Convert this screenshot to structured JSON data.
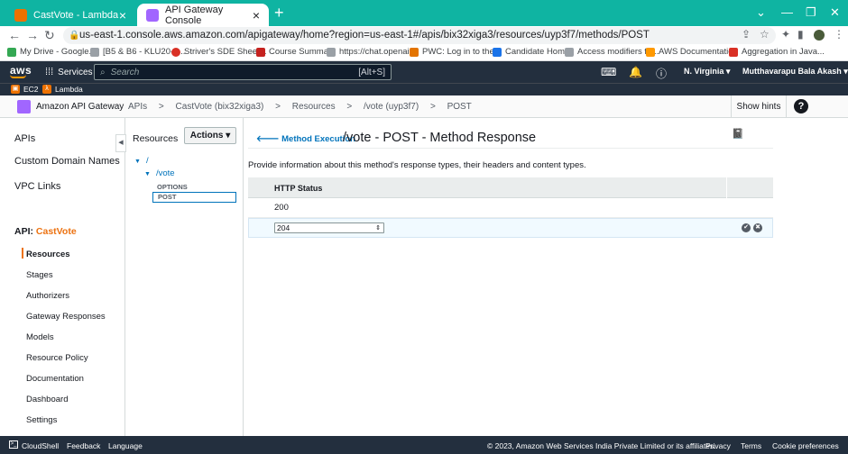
{
  "browser": {
    "tabs": [
      {
        "title": "CastVote - Lambda",
        "active": false
      },
      {
        "title": "API Gateway Console",
        "active": true
      }
    ],
    "url": "us-east-1.console.aws.amazon.com/apigateway/home?region=us-east-1#/apis/bix32xiga3/resources/uyp3f7/methods/POST",
    "bookmarks": [
      "My Drive - Google...",
      "[B5 & B6 - KLU20-2...",
      "Striver's SDE Sheet...",
      "Course Summary",
      "https://chat.openai....",
      "PWC: Log in to the...",
      "Candidate Home",
      "Access modifiers fo...",
      "AWS Documentation",
      "Aggregation in Java..."
    ]
  },
  "aws_header": {
    "logo": "aws",
    "services": "Services",
    "search_placeholder": "Search",
    "search_shortcut": "[Alt+S]",
    "region": "N. Virginia ▾",
    "user": "Mutthavarapu Bala Akash ▾"
  },
  "shortcuts": [
    "EC2",
    "Lambda"
  ],
  "console_bar": {
    "service": "Amazon API Gateway",
    "breadcrumbs": [
      "APIs",
      ">",
      "CastVote (bix32xiga3)",
      ">",
      "Resources",
      ">",
      "/vote (uyp3f7)",
      ">",
      "POST"
    ],
    "show_hints": "Show hints",
    "help": "?"
  },
  "left_nav": {
    "top_items": [
      "APIs",
      "Custom Domain Names",
      "VPC Links"
    ],
    "api_label": "API:",
    "api_name": "CastVote",
    "sub_items": [
      "Resources",
      "Stages",
      "Authorizers",
      "Gateway Responses",
      "Models",
      "Resource Policy",
      "Documentation",
      "Dashboard",
      "Settings"
    ]
  },
  "resources_panel": {
    "title": "Resources",
    "actions": "Actions ▾",
    "tree": {
      "root": "/",
      "child": "/vote",
      "methods": [
        "OPTIONS",
        "POST"
      ]
    }
  },
  "content": {
    "back_link": "Method Execution",
    "title": "/vote - POST - Method Response",
    "description": "Provide information about this method's response types, their headers and content types.",
    "table_header": "HTTP Status",
    "rows": [
      "200"
    ],
    "new_status_value": "204"
  },
  "footer": {
    "cloudshell": "CloudShell",
    "feedback": "Feedback",
    "language": "Language",
    "copyright": "© 2023, Amazon Web Services India Private Limited or its affiliates.",
    "privacy": "Privacy",
    "terms": "Terms",
    "cookies": "Cookie preferences"
  },
  "colors": {
    "aws_dark": "#232f3e",
    "aws_orange": "#ec7211",
    "link_blue": "#0073bb",
    "tab_strip": "#0fb4a2"
  }
}
